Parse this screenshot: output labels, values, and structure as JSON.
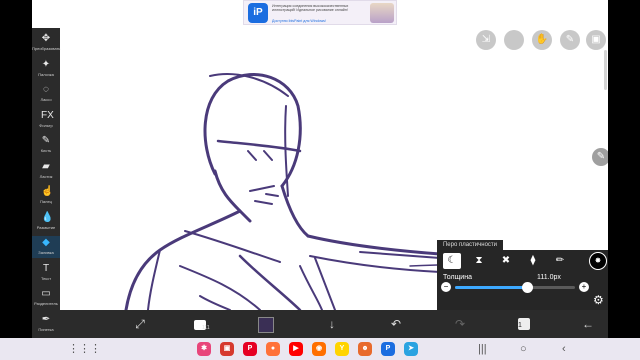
{
  "ad": {
    "logo_text": "iP",
    "text": "Интеграция соединения высококачественных иллюстраций! Идеальное рисование онлайн!",
    "cta": "Доступно ibisPaint для Windows!"
  },
  "toolbar": {
    "tools": [
      {
        "label": "Преобразовать",
        "icon": "✥"
      },
      {
        "label": "Палочка",
        "icon": "✦"
      },
      {
        "label": "Лассо",
        "icon": "◌"
      },
      {
        "label": "Фильтр",
        "icon": "FX"
      },
      {
        "label": "Кисть",
        "icon": "✎"
      },
      {
        "label": "Ластик",
        "icon": "▰"
      },
      {
        "label": "Палец",
        "icon": "☝"
      },
      {
        "label": "Размытие",
        "icon": "💧"
      },
      {
        "label": "Заливка",
        "icon": "◆"
      },
      {
        "label": "Текст",
        "icon": "T"
      },
      {
        "label": "Разделитель",
        "icon": "▭"
      },
      {
        "label": "Пипетка",
        "icon": "✒"
      }
    ],
    "active_index": 8
  },
  "top_tools": [
    "layer-move-icon",
    "circle-tool-icon",
    "hand-icon",
    "pencil-icon",
    "reference-icon"
  ],
  "pen_panel": {
    "title": "Перо пластичности",
    "thickness_label": "Толщина",
    "thickness_value": "111.0px",
    "thickness_fraction": 0.6,
    "pen_types": [
      "☾",
      "⧗",
      "✖",
      "⧫",
      "✏"
    ],
    "selected_pen_index": 0
  },
  "bottom_bar": {
    "layers_count": "1",
    "brush_size": "111"
  },
  "dock_apps": [
    {
      "name": "app-pink",
      "color": "#e8457a",
      "glyph": "✱"
    },
    {
      "name": "app-red",
      "color": "#d6392e",
      "glyph": "▣"
    },
    {
      "name": "pinterest",
      "color": "#e60023",
      "glyph": "P"
    },
    {
      "name": "firefox",
      "color": "#ff7139",
      "glyph": "●"
    },
    {
      "name": "youtube",
      "color": "#ff0000",
      "glyph": "▶"
    },
    {
      "name": "app-circle",
      "color": "#ff6f00",
      "glyph": "◉"
    },
    {
      "name": "yandex",
      "color": "#ffd400",
      "glyph": "Y"
    },
    {
      "name": "app-orange",
      "color": "#e86a2c",
      "glyph": "☻"
    },
    {
      "name": "ibispaint",
      "color": "#1b6de0",
      "glyph": "P"
    },
    {
      "name": "telegram",
      "color": "#2aa3e1",
      "glyph": "➤"
    }
  ],
  "colors": {
    "toolbar_bg": "#2b2b2b",
    "accent": "#38b7ff",
    "sketch_stroke": "#4a3a7a",
    "current_color": "#3a2f55"
  }
}
